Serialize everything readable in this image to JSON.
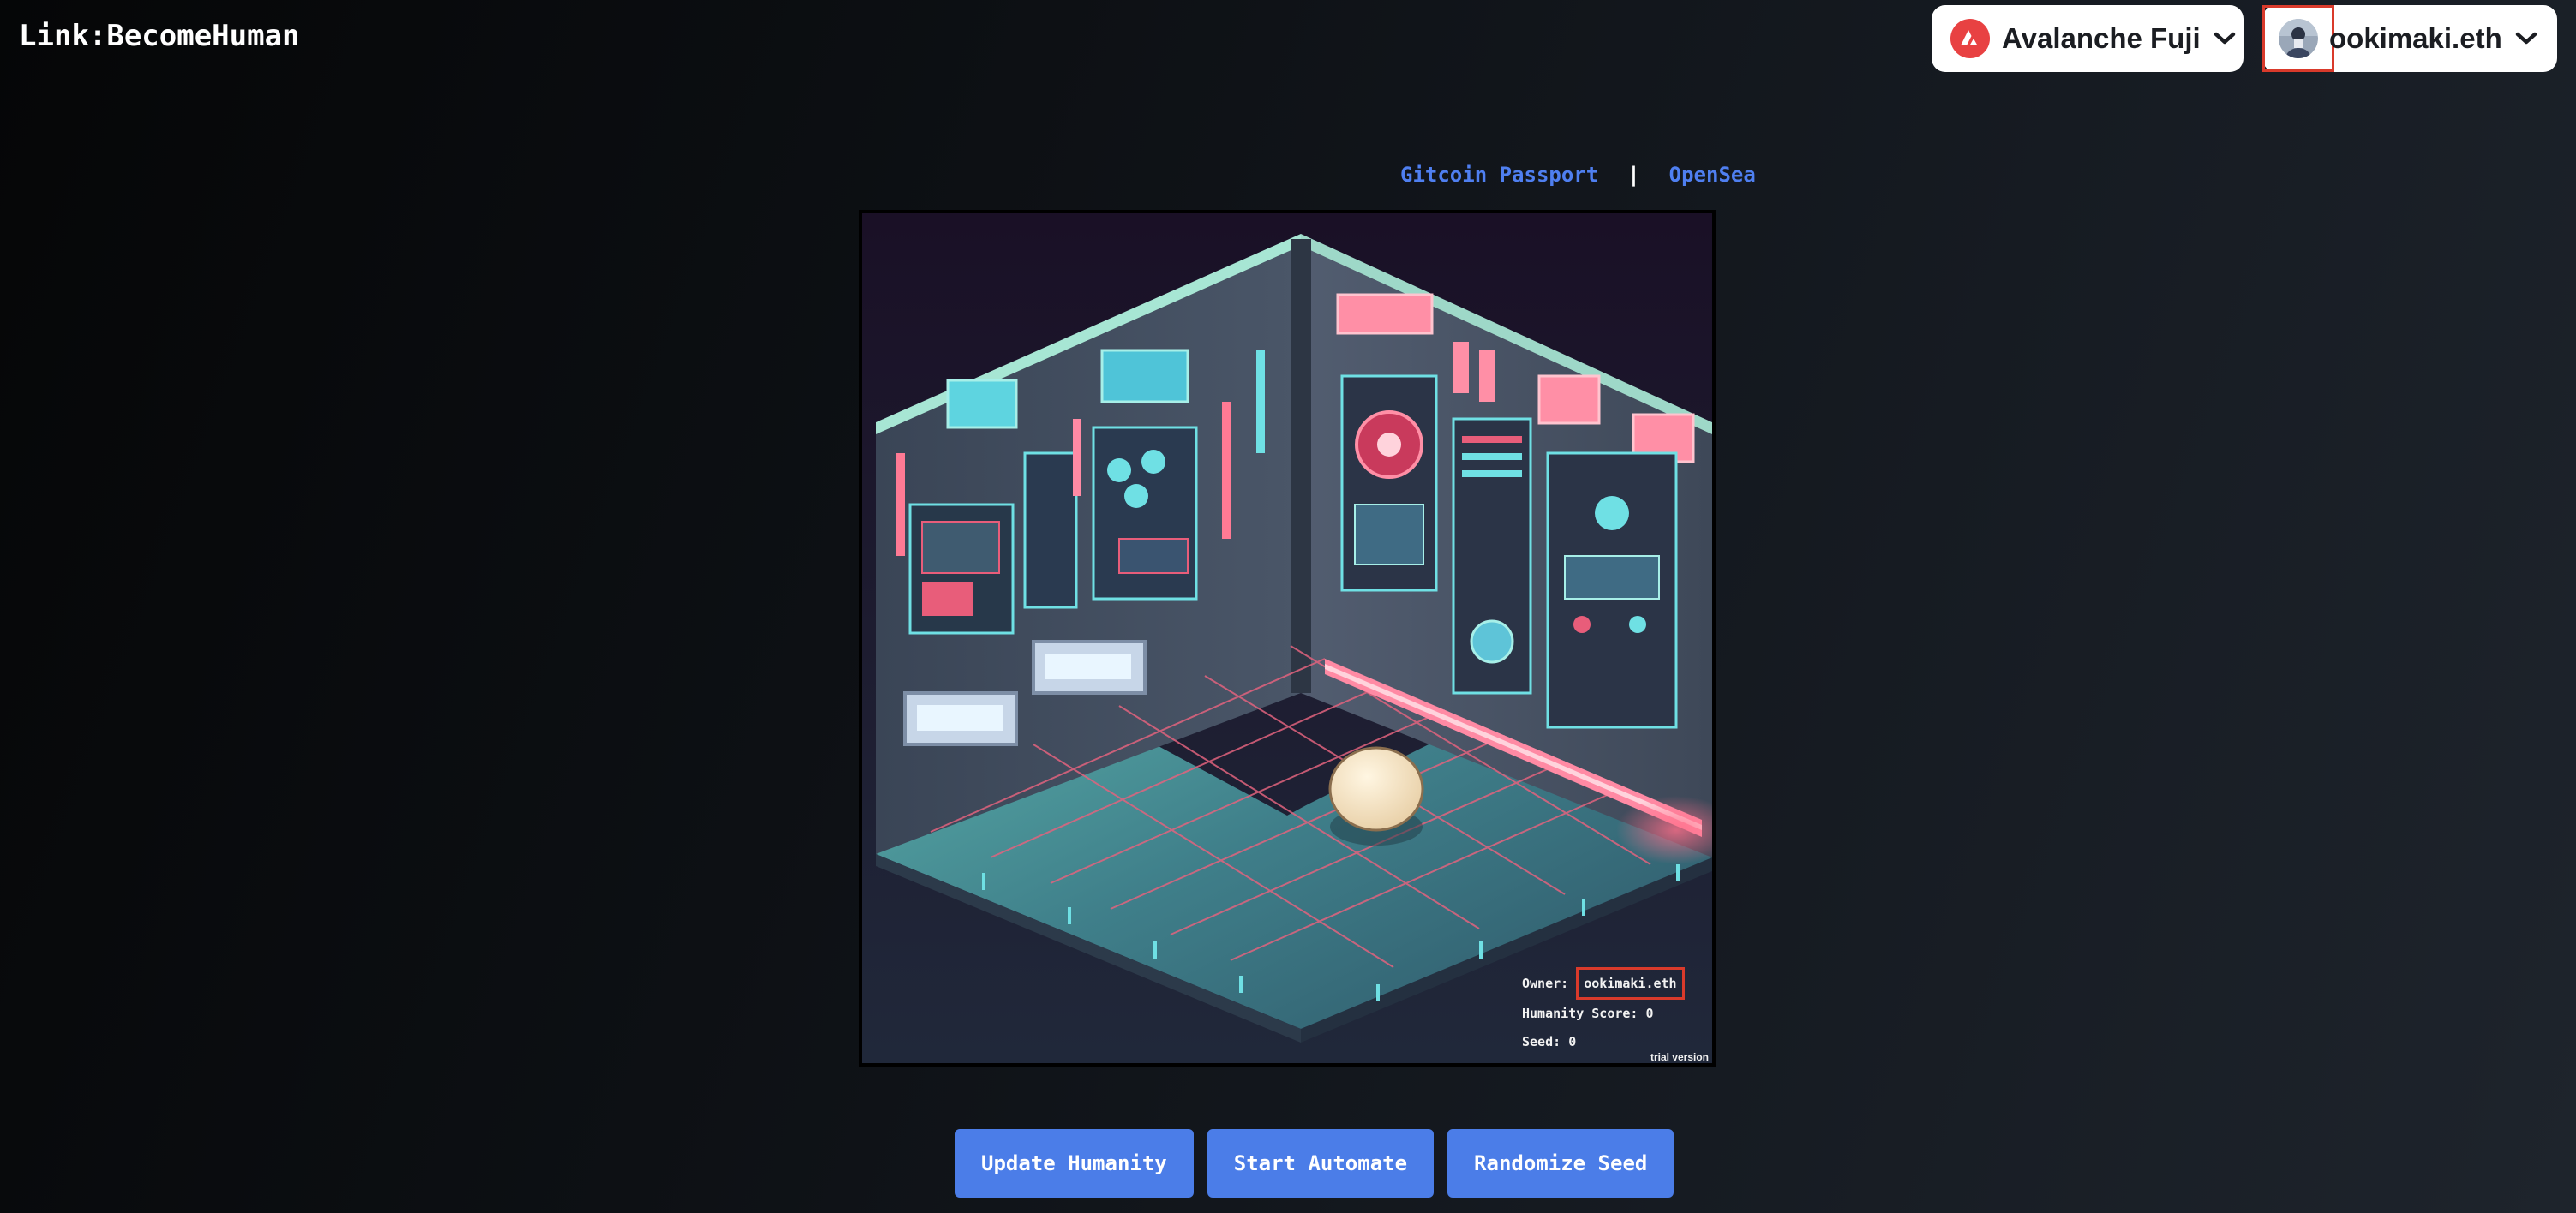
{
  "header": {
    "brand": "Link:BecomeHuman",
    "network": {
      "label": "Avalanche Fuji",
      "icon": "avalanche-logo-icon",
      "color": "#e84142"
    },
    "account": {
      "label": "ookimaki.eth",
      "icon": "avatar"
    }
  },
  "links": {
    "gitcoin": "Gitcoin Passport",
    "separator": "|",
    "opensea": "OpenSea",
    "color": "#4f7ff0"
  },
  "artwork": {
    "owner_label": "Owner:",
    "owner_value": "ookimaki.eth",
    "score_label": "Humanity Score:",
    "score_value": "0",
    "seed_label": "Seed:",
    "seed_value": "0",
    "watermark": "trial version"
  },
  "actions": {
    "update": "Update Humanity",
    "automate": "Start Automate",
    "randomize": "Randomize Seed",
    "color": "#4b7de8"
  }
}
